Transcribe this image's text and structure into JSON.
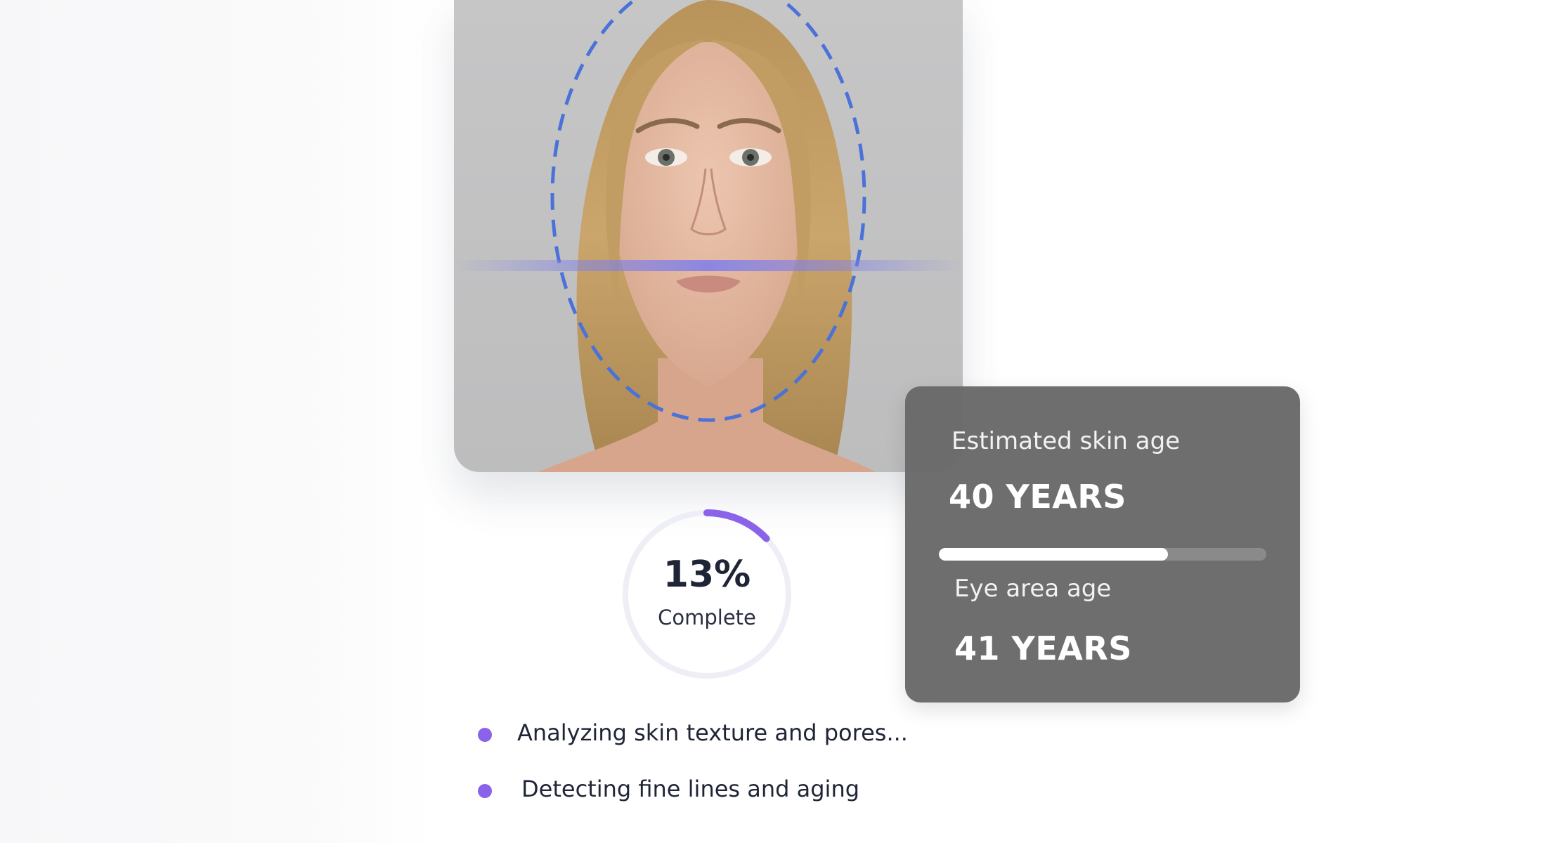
{
  "scan": {
    "progress_percent": 13,
    "progress_text": "13%",
    "progress_label": "Complete",
    "accent_color": "#8a63ea",
    "face_guide_color": "#4a72d8"
  },
  "status_items": [
    {
      "text": "Analyzing skin texture and pores..."
    },
    {
      "text": "Detecting fine lines and aging"
    }
  ],
  "results": {
    "skin_age_label": "Estimated skin age",
    "skin_age_value": "40 YEARS",
    "skin_age_bar_fraction": 0.7,
    "eye_age_label": "Eye area age",
    "eye_age_value": "41 YEARS"
  }
}
